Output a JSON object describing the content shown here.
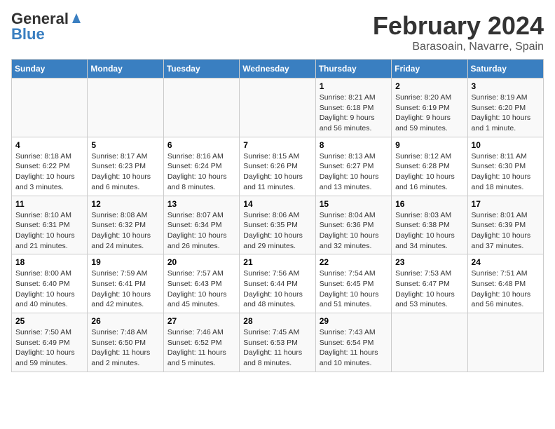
{
  "header": {
    "logo_general": "General",
    "logo_blue": "Blue",
    "title": "February 2024",
    "subtitle": "Barasoain, Navarre, Spain"
  },
  "days_of_week": [
    "Sunday",
    "Monday",
    "Tuesday",
    "Wednesday",
    "Thursday",
    "Friday",
    "Saturday"
  ],
  "weeks": [
    [
      {
        "day": "",
        "info": ""
      },
      {
        "day": "",
        "info": ""
      },
      {
        "day": "",
        "info": ""
      },
      {
        "day": "",
        "info": ""
      },
      {
        "day": "1",
        "info": "Sunrise: 8:21 AM\nSunset: 6:18 PM\nDaylight: 9 hours\nand 56 minutes."
      },
      {
        "day": "2",
        "info": "Sunrise: 8:20 AM\nSunset: 6:19 PM\nDaylight: 9 hours\nand 59 minutes."
      },
      {
        "day": "3",
        "info": "Sunrise: 8:19 AM\nSunset: 6:20 PM\nDaylight: 10 hours\nand 1 minute."
      }
    ],
    [
      {
        "day": "4",
        "info": "Sunrise: 8:18 AM\nSunset: 6:22 PM\nDaylight: 10 hours\nand 3 minutes."
      },
      {
        "day": "5",
        "info": "Sunrise: 8:17 AM\nSunset: 6:23 PM\nDaylight: 10 hours\nand 6 minutes."
      },
      {
        "day": "6",
        "info": "Sunrise: 8:16 AM\nSunset: 6:24 PM\nDaylight: 10 hours\nand 8 minutes."
      },
      {
        "day": "7",
        "info": "Sunrise: 8:15 AM\nSunset: 6:26 PM\nDaylight: 10 hours\nand 11 minutes."
      },
      {
        "day": "8",
        "info": "Sunrise: 8:13 AM\nSunset: 6:27 PM\nDaylight: 10 hours\nand 13 minutes."
      },
      {
        "day": "9",
        "info": "Sunrise: 8:12 AM\nSunset: 6:28 PM\nDaylight: 10 hours\nand 16 minutes."
      },
      {
        "day": "10",
        "info": "Sunrise: 8:11 AM\nSunset: 6:30 PM\nDaylight: 10 hours\nand 18 minutes."
      }
    ],
    [
      {
        "day": "11",
        "info": "Sunrise: 8:10 AM\nSunset: 6:31 PM\nDaylight: 10 hours\nand 21 minutes."
      },
      {
        "day": "12",
        "info": "Sunrise: 8:08 AM\nSunset: 6:32 PM\nDaylight: 10 hours\nand 24 minutes."
      },
      {
        "day": "13",
        "info": "Sunrise: 8:07 AM\nSunset: 6:34 PM\nDaylight: 10 hours\nand 26 minutes."
      },
      {
        "day": "14",
        "info": "Sunrise: 8:06 AM\nSunset: 6:35 PM\nDaylight: 10 hours\nand 29 minutes."
      },
      {
        "day": "15",
        "info": "Sunrise: 8:04 AM\nSunset: 6:36 PM\nDaylight: 10 hours\nand 32 minutes."
      },
      {
        "day": "16",
        "info": "Sunrise: 8:03 AM\nSunset: 6:38 PM\nDaylight: 10 hours\nand 34 minutes."
      },
      {
        "day": "17",
        "info": "Sunrise: 8:01 AM\nSunset: 6:39 PM\nDaylight: 10 hours\nand 37 minutes."
      }
    ],
    [
      {
        "day": "18",
        "info": "Sunrise: 8:00 AM\nSunset: 6:40 PM\nDaylight: 10 hours\nand 40 minutes."
      },
      {
        "day": "19",
        "info": "Sunrise: 7:59 AM\nSunset: 6:41 PM\nDaylight: 10 hours\nand 42 minutes."
      },
      {
        "day": "20",
        "info": "Sunrise: 7:57 AM\nSunset: 6:43 PM\nDaylight: 10 hours\nand 45 minutes."
      },
      {
        "day": "21",
        "info": "Sunrise: 7:56 AM\nSunset: 6:44 PM\nDaylight: 10 hours\nand 48 minutes."
      },
      {
        "day": "22",
        "info": "Sunrise: 7:54 AM\nSunset: 6:45 PM\nDaylight: 10 hours\nand 51 minutes."
      },
      {
        "day": "23",
        "info": "Sunrise: 7:53 AM\nSunset: 6:47 PM\nDaylight: 10 hours\nand 53 minutes."
      },
      {
        "day": "24",
        "info": "Sunrise: 7:51 AM\nSunset: 6:48 PM\nDaylight: 10 hours\nand 56 minutes."
      }
    ],
    [
      {
        "day": "25",
        "info": "Sunrise: 7:50 AM\nSunset: 6:49 PM\nDaylight: 10 hours\nand 59 minutes."
      },
      {
        "day": "26",
        "info": "Sunrise: 7:48 AM\nSunset: 6:50 PM\nDaylight: 11 hours\nand 2 minutes."
      },
      {
        "day": "27",
        "info": "Sunrise: 7:46 AM\nSunset: 6:52 PM\nDaylight: 11 hours\nand 5 minutes."
      },
      {
        "day": "28",
        "info": "Sunrise: 7:45 AM\nSunset: 6:53 PM\nDaylight: 11 hours\nand 8 minutes."
      },
      {
        "day": "29",
        "info": "Sunrise: 7:43 AM\nSunset: 6:54 PM\nDaylight: 11 hours\nand 10 minutes."
      },
      {
        "day": "",
        "info": ""
      },
      {
        "day": "",
        "info": ""
      }
    ]
  ]
}
